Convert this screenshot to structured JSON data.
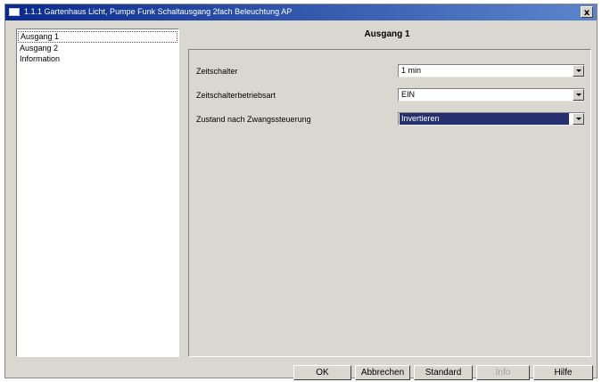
{
  "window": {
    "title": "1.1.1 Gartenhaus Licht, Pumpe Funk Schaltausgang 2fach Beleuchtung AP",
    "close_label": "x"
  },
  "nav": {
    "items": [
      {
        "label": "Ausgang 1",
        "selected": true
      },
      {
        "label": "Ausgang 2",
        "selected": false
      },
      {
        "label": "Information",
        "selected": false
      }
    ]
  },
  "main": {
    "header": "Ausgang 1",
    "params": [
      {
        "label": "Zeitschalter",
        "value": "1 min"
      },
      {
        "label": "Zeitschalterbetriebsart",
        "value": "EIN"
      },
      {
        "label": "Zustand nach Zwangssteuerung",
        "value": "Invertieren"
      }
    ]
  },
  "buttons": {
    "ok": "OK",
    "cancel": "Abbrechen",
    "default": "Standard",
    "info": "Info",
    "help": "Hilfe"
  },
  "colors": {
    "title_bar_start": "#0a2a8c",
    "title_bar_end": "#5b86cc",
    "dialog_bg": "#d9d7cf",
    "selection": "#27306e"
  }
}
